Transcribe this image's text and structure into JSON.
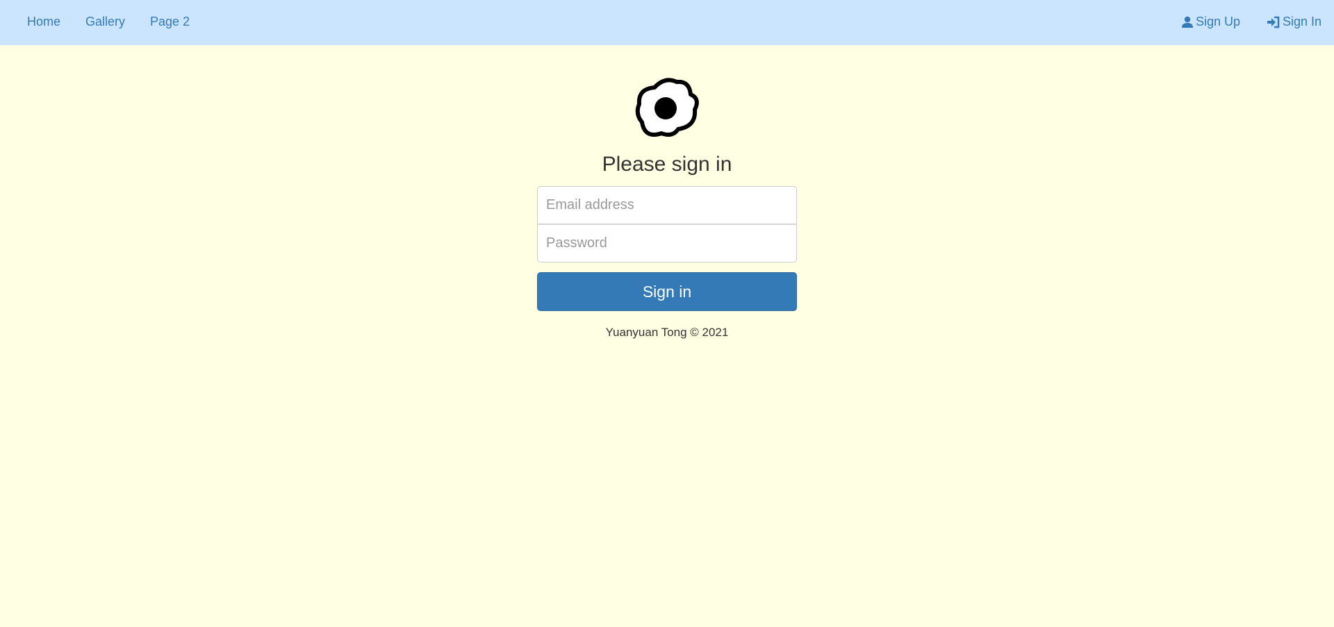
{
  "nav": {
    "left": [
      {
        "label": "Home"
      },
      {
        "label": "Gallery"
      },
      {
        "label": "Page 2"
      }
    ],
    "sign_up": {
      "label": "Sign Up",
      "icon": "user-icon"
    },
    "sign_in": {
      "label": "Sign In",
      "icon": "log-in-icon"
    }
  },
  "form": {
    "logo_icon": "fried-egg-icon",
    "heading": "Please sign in",
    "email_placeholder": "Email address",
    "password_placeholder": "Password",
    "submit_label": "Sign in"
  },
  "footer": {
    "text": "Yuanyuan Tong © 2021"
  },
  "colors": {
    "navbar": "#cce5ff",
    "background": "#ffffe3",
    "link": "#337ab7",
    "primary": "#337ab7"
  }
}
